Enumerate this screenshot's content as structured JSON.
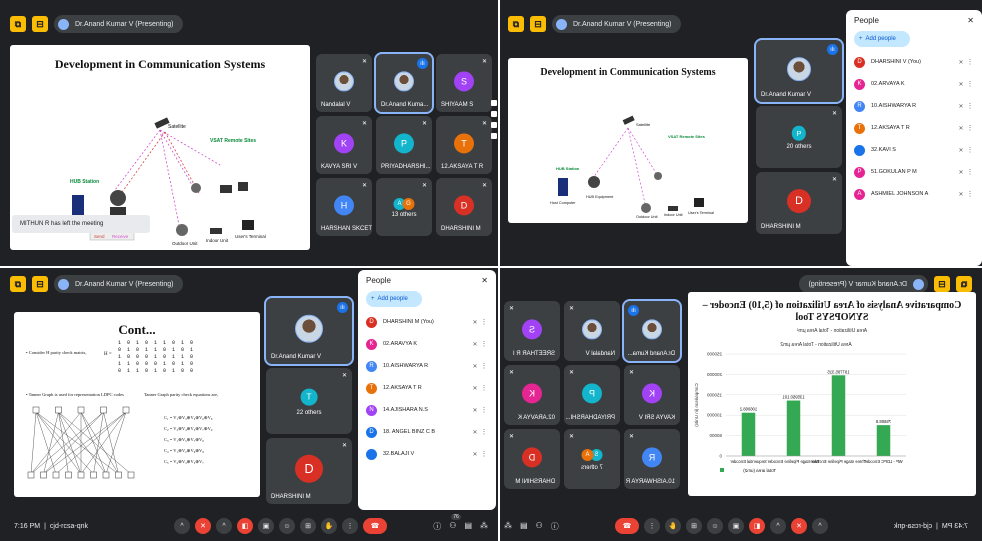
{
  "meeting": {
    "presenter_label": "Dr.Anand Kumar V (Presenting)",
    "time": "7:16 PM",
    "separator": "|",
    "code": "cjd-rcsa-qnk",
    "time_mirrored": "7:43 PM",
    "left_notice": "MITHUN R has left the meeting",
    "badge_count": "76"
  },
  "slide_comm": {
    "title": "Development in Communication Systems",
    "satellite": "Satellite",
    "vsat": "VSAT Remote Sites",
    "hub_station": "HUB Station",
    "host_computer": "Host Computer",
    "hub_equipment": "HUB Equipment",
    "outdoor_unit": "Outdoor Unit",
    "indoor_unit": "Indoor Unit",
    "users_terminal": "User's Terminal",
    "send": "Send",
    "receive": "Receive"
  },
  "slide_cont": {
    "title": "Cont...",
    "bullet1": "Consider H parity check matrix,",
    "bullet2": "Tanner Graph is used for representation LDPC codes",
    "tanner_caption": "Tanner Graph parity check equations are,",
    "h_label": "H =",
    "matrix": [
      "1 0 1 0 1 1 0 1 0",
      "0 1 0 1 1 0 1 0 1",
      "1 0 0 0 1 0 1 1 0",
      "1 1 0 0 0 1 0 1 0",
      "0 1 1 0 1 0 1 0 0"
    ],
    "equations": [
      "C₁ = V₁⊕V₃⊕V₅⊕V₆⊕V₈",
      "C₂ = V₂⊕V₄⊕V₅⊕V₇⊕V₉",
      "C₃ = V₁⊕V₅⊕V₇⊕V₈",
      "C₄ = V₁⊕V₂⊕V₆⊕V₈",
      "C₅ = V₂⊕V₃⊕V₅⊕V₇"
    ]
  },
  "slide_area": {
    "title": "Comparative Analysis of Area Utilization of (5,10) Encoder – SYNOPSYS Tool",
    "subtitle": "Area Utilization - Total Area µm²",
    "chart_title": "Area Utilization - Total Area µm2",
    "ylabel": "Comparison (in Units)",
    "legend": "Total area (um2)"
  },
  "chart_data": {
    "type": "bar",
    "title": "Area Utilization - Total Area µm2",
    "ylabel": "Comparison (in Units)",
    "categories": [
      "WP - LDPC Encoder",
      "Three stage Pipeline Encoder",
      "Two stage Pipeline Encoder",
      "Sequential Encoder"
    ],
    "series": [
      {
        "name": "Total area (um2)",
        "values": [
          75608.8,
          197795.315,
          135950.101,
          106068.2
        ]
      }
    ],
    "data_labels": [
      "75608.8",
      "197795.315",
      "135950.101",
      "106068.2"
    ],
    "yticks": [
      "0",
      "50000",
      "100000",
      "150000",
      "200000",
      "250000"
    ],
    "ylim": [
      0,
      250000
    ],
    "colors": {
      "bar": "#34a853"
    }
  },
  "tiles_tl": [
    {
      "name": "Nandalal V",
      "kind": "photo"
    },
    {
      "name": "Dr.Anand Kuma...",
      "kind": "photo",
      "active": true
    },
    {
      "name": "SHIYAAM S",
      "kind": "letter",
      "letter": "S",
      "color": "#a142f4"
    },
    {
      "name": "KAVYA SRI V",
      "kind": "letter",
      "letter": "K",
      "color": "#a142f4"
    },
    {
      "name": "PRIYADHARSHI...",
      "kind": "letter",
      "letter": "P",
      "color": "#12b5cb"
    },
    {
      "name": "12.AKSAYA T R",
      "kind": "letter",
      "letter": "T",
      "color": "#e8710a"
    },
    {
      "name": "HARSHAN SKCET",
      "kind": "letter",
      "letter": "H",
      "color": "#4285f4"
    },
    {
      "name": "13 others",
      "kind": "others",
      "letters": [
        "A",
        "G"
      ]
    },
    {
      "name": "DHARSHINI M",
      "kind": "letter",
      "letter": "D",
      "color": "#d93025"
    }
  ],
  "tiles_tr": [
    {
      "name": "Dr.Anand Kumar V",
      "kind": "photo",
      "active": true
    },
    {
      "name": "20 others",
      "kind": "others",
      "letters": [
        "P"
      ]
    },
    {
      "name": "DHARSHINI M",
      "kind": "letter",
      "letter": "D",
      "color": "#d93025"
    }
  ],
  "tiles_bl": [
    {
      "name": "Dr.Anand Kumar V",
      "kind": "photo",
      "active": true
    },
    {
      "name": "22 others",
      "kind": "others",
      "letters": [
        "T"
      ]
    },
    {
      "name": "DHARSHINI M",
      "kind": "letter",
      "letter": "D",
      "color": "#d93025"
    }
  ],
  "tiles_br": [
    {
      "name": "Dr.Anand Kuma...",
      "kind": "photo",
      "active": true
    },
    {
      "name": "Nandalal V",
      "kind": "photo"
    },
    {
      "name": "SREETHAR R I",
      "kind": "letter",
      "letter": "S",
      "color": "#a142f4"
    },
    {
      "name": "KAVYA SRI V",
      "kind": "letter",
      "letter": "K",
      "color": "#a142f4"
    },
    {
      "name": "PRIYADHARSHI...",
      "kind": "letter",
      "letter": "P",
      "color": "#12b5cb"
    },
    {
      "name": "02.ARAVYA K",
      "kind": "letter",
      "letter": "K",
      "color": "#e52592"
    },
    {
      "name": "10.AISHWARYA R",
      "kind": "letter",
      "letter": "R",
      "color": "#4285f4"
    },
    {
      "name": "7 others",
      "kind": "others",
      "letters": [
        "S",
        "A"
      ]
    },
    {
      "name": "DHARSHINI M",
      "kind": "letter",
      "letter": "D",
      "color": "#d93025"
    }
  ],
  "people_tr": {
    "title": "People",
    "add": "Add people",
    "list": [
      {
        "name": "DHARSHINI V (You)",
        "letter": "D",
        "color": "#d93025"
      },
      {
        "name": "02.ARVAYA K",
        "letter": "K",
        "color": "#e52592"
      },
      {
        "name": "10.AISHWARYA R",
        "letter": "R",
        "color": "#4285f4"
      },
      {
        "name": "12.AKSAYA T R",
        "letter": "T",
        "color": "#e8710a"
      },
      {
        "name": "32.KAVI S",
        "letter": "",
        "color": "#1a73e8"
      },
      {
        "name": "51.GOKULAN P M",
        "letter": "P",
        "color": "#e52592"
      },
      {
        "name": "ASHMIEL JOHNSON A",
        "letter": "A",
        "color": "#e52592"
      }
    ]
  },
  "people_bl": {
    "title": "People",
    "add": "Add people",
    "list": [
      {
        "name": "DHARSHINI M (You)",
        "letter": "D",
        "color": "#d93025"
      },
      {
        "name": "02.ARAVYA K",
        "letter": "K",
        "color": "#e52592"
      },
      {
        "name": "10.AISHWARYA R",
        "letter": "R",
        "color": "#4285f4"
      },
      {
        "name": "12.AKSAYA T R",
        "letter": "T",
        "color": "#e8710a"
      },
      {
        "name": "14.AJISHARA N.S",
        "letter": "N",
        "color": "#a142f4"
      },
      {
        "name": "18. ANGEL BINZ C B",
        "letter": "D",
        "color": "#1a73e8"
      },
      {
        "name": "32.BALAJI V",
        "letter": "",
        "color": "#1a73e8"
      }
    ]
  },
  "icons": {
    "mic_off": "✕",
    "more": "⋮",
    "close": "✕",
    "add": "+",
    "speaking": "ılı",
    "info": "ⓘ",
    "people": "👥",
    "chat": "▤",
    "activities": "⁂",
    "leave": "☎",
    "raise_hand": "✋",
    "emoji": "☺",
    "present": "⊞",
    "captions": "▣"
  }
}
